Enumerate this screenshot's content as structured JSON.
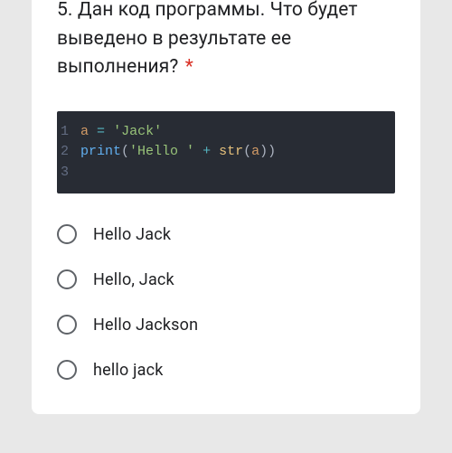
{
  "question": {
    "number": "5.",
    "text": "Дан код программы. Что будет выведено в результате ее выполнения?",
    "required_mark": "*"
  },
  "code": {
    "lines": [
      {
        "num": "1",
        "tokens": [
          {
            "t": "a",
            "c": "c-var"
          },
          {
            "t": " ",
            "c": "c-plain"
          },
          {
            "t": "=",
            "c": "c-op"
          },
          {
            "t": " ",
            "c": "c-plain"
          },
          {
            "t": "'Jack'",
            "c": "c-str"
          }
        ]
      },
      {
        "num": "2",
        "tokens": [
          {
            "t": "print",
            "c": "c-func"
          },
          {
            "t": "(",
            "c": "c-paren"
          },
          {
            "t": "'Hello '",
            "c": "c-str"
          },
          {
            "t": " ",
            "c": "c-plain"
          },
          {
            "t": "+",
            "c": "c-op"
          },
          {
            "t": " ",
            "c": "c-plain"
          },
          {
            "t": "str",
            "c": "c-builtin"
          },
          {
            "t": "(",
            "c": "c-paren"
          },
          {
            "t": "a",
            "c": "c-var"
          },
          {
            "t": "))",
            "c": "c-paren"
          }
        ]
      },
      {
        "num": "3",
        "tokens": []
      }
    ]
  },
  "options": [
    {
      "label": "Hello Jack"
    },
    {
      "label": "Hello, Jack"
    },
    {
      "label": "Hello Jackson"
    },
    {
      "label": "hello jack"
    }
  ]
}
